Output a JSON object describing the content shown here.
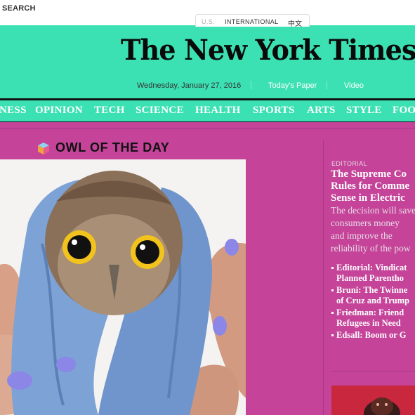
{
  "topbar": {
    "search_label": "SEARCH",
    "editions": {
      "us": "U.S.",
      "international": "INTERNATIONAL",
      "chinese": "中文"
    }
  },
  "masthead": {
    "logo_text": "The New York Times",
    "date": "Wednesday, January 27, 2016",
    "todays_paper": "Today's Paper",
    "video": "Video"
  },
  "nav": {
    "items": [
      "NESS",
      "OPINION",
      "TECH",
      "SCIENCE",
      "HEALTH",
      "SPORTS",
      "ARTS",
      "STYLE",
      "FOO"
    ]
  },
  "feature": {
    "heading": "OWL OF THE DAY",
    "photo_subject": "owl-in-blue-towel"
  },
  "editorial": {
    "kicker": "EDITORIAL",
    "headline": "The Supreme Co\nRules for Comme\nSense in Electric",
    "summary": "The decision will save\nconsumers money\nand improve the\nreliability of the pow"
  },
  "related": [
    "Editorial: Vindicat\nPlanned Parentho",
    "Bruni: The Twinne\nof Cruz and Trump",
    "Friedman: Friend\nRefugees in Need",
    "Edsall: Boom or G"
  ],
  "colors": {
    "teal": "#3ce1b3",
    "pink": "#c5449a",
    "thumb_red": "#c8273d"
  }
}
